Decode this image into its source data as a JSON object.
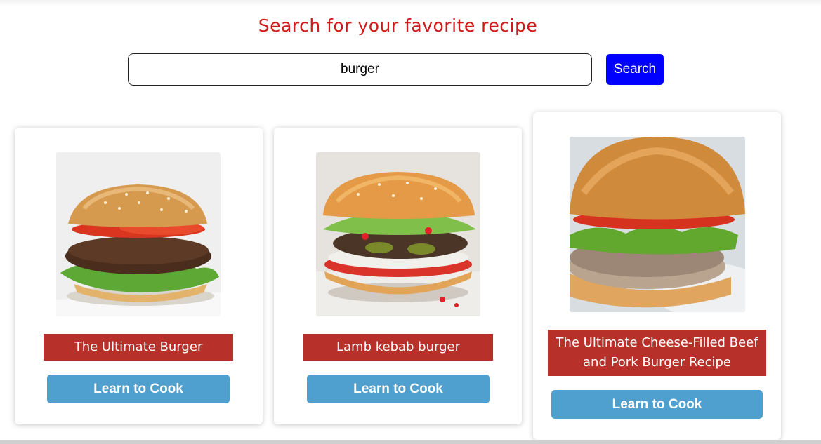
{
  "page": {
    "heading": "Search for your favorite recipe"
  },
  "search": {
    "value": "burger",
    "button_label": "Search"
  },
  "recipes": [
    {
      "title": "The Ultimate Burger",
      "button_label": "Learn to Cook"
    },
    {
      "title": "Lamb kebab burger",
      "button_label": "Learn to Cook"
    },
    {
      "title": "The Ultimate Cheese-Filled Beef and Pork Burger Recipe",
      "button_label": "Learn to Cook"
    }
  ],
  "colors": {
    "heading": "#d11a1a",
    "search_button": "#0000ff",
    "title_background": "#b8302a",
    "learn_button": "#4f9fcf"
  }
}
